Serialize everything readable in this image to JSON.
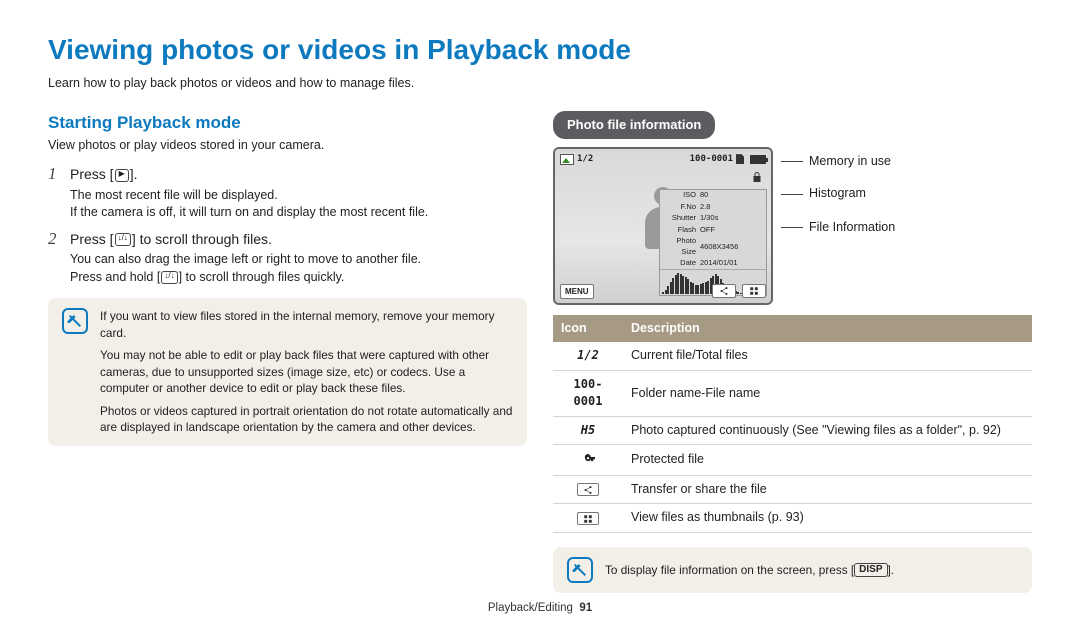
{
  "page": {
    "title": "Viewing photos or videos in Playback mode",
    "intro": "Learn how to play back photos or videos and how to manage files.",
    "section_title": "Starting Playback mode",
    "section_desc": "View photos or play videos stored in your camera.",
    "step1": {
      "num": "1",
      "pre": "Press [",
      "post": "].",
      "sub1": "The most recent file will be displayed.",
      "sub2": "If the camera is off, it will turn on and display the most recent file."
    },
    "step2": {
      "num": "2",
      "pre": "Press [",
      "mid": "] to scroll through files.",
      "sub1": "You can also drag the image left or right to move to another file.",
      "sub2a": "Press and hold [",
      "sub2b": "] to scroll through files quickly."
    },
    "note1": {
      "p1": "If you want to view files stored in the internal memory, remove your memory card.",
      "p2": "You may not be able to edit or play back files that were captured with other cameras, due to unsupported sizes (image size, etc) or codecs. Use a computer or another device to edit or play back these files.",
      "p3": "Photos or videos captured in portrait orientation do not rotate automatically and are displayed in landscape orientation by the camera and other devices."
    },
    "photo_info_label": "Photo file information",
    "callouts": {
      "c1": "Memory in use",
      "c2": "Histogram",
      "c3": "File Information"
    },
    "lcd": {
      "counter": "1/2",
      "folderfile": "100-0001",
      "menu": "MENU",
      "info": {
        "iso_l": "ISO",
        "iso": "80",
        "fno_l": "F.No",
        "fno": "2.8",
        "shutter_l": "Shutter",
        "shutter": "1/30s",
        "flash_l": "Flash",
        "flash": "OFF",
        "size_l": "Photo Size",
        "size": "4608X3456",
        "date_l": "Date",
        "date": "2014/01/01"
      }
    },
    "table": {
      "h1": "Icon",
      "h2": "Description",
      "r1": {
        "icon": "1/2",
        "desc": "Current file/Total files"
      },
      "r2": {
        "icon": "100-0001",
        "desc": "Folder name-File name"
      },
      "r3": {
        "icon": "H5",
        "desc": "Photo captured continuously (See \"Viewing files as a folder\", p. 92)"
      },
      "r4": {
        "desc": "Protected file"
      },
      "r5": {
        "desc": "Transfer or share the file"
      },
      "r6": {
        "desc": "View files as thumbnails (p. 93)"
      }
    },
    "note2a": "To display file information on the screen, press [",
    "note2b": "DISP",
    "note2c": "].",
    "footer": {
      "section": "Playback/Editing",
      "page": "91"
    }
  }
}
